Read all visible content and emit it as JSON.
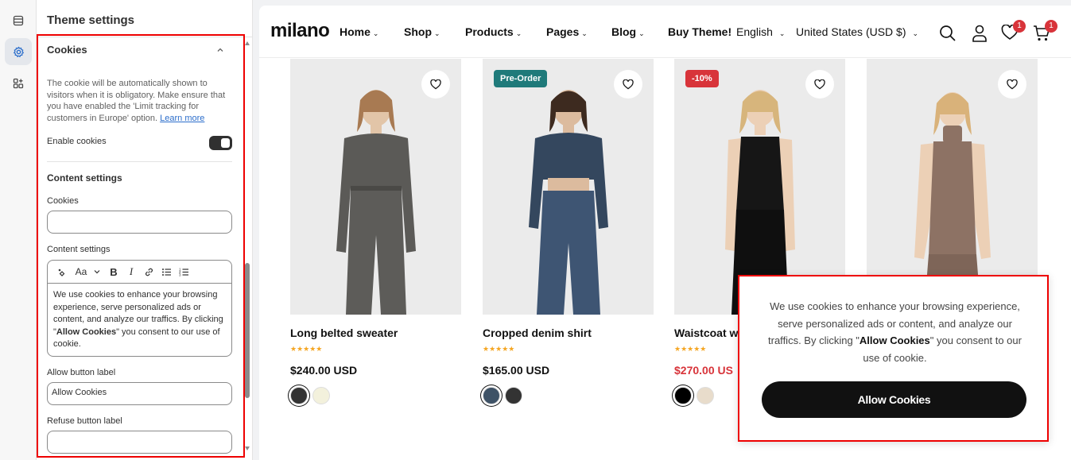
{
  "sidebar": {
    "title": "Theme settings",
    "section": {
      "title": "Cookies",
      "description": "The cookie will be automatically shown to visitors when it is obligatory. Make ensure that you have enabled the 'Limit tracking for customers in Europe' option.",
      "learn_more": "Learn more",
      "enable_label": "Enable cookies",
      "enable_value": true
    },
    "content": {
      "title": "Content settings",
      "cookies_label": "Cookies",
      "cookies_value": "",
      "rte_label": "Content settings",
      "rte_text_pre": "We use cookies to enhance your browsing experience, serve personalized ads or content, and analyze our traffics. By clicking \"",
      "rte_text_bold": "Allow Cookies",
      "rte_text_post": "\" you consent to our use of cookie.",
      "rte_font_label": "Aa",
      "allow_label": "Allow button label",
      "allow_value": "Allow Cookies",
      "refuse_label": "Refuse button label",
      "refuse_value": ""
    }
  },
  "store": {
    "logo": "milano",
    "nav": [
      "Home",
      "Shop",
      "Products",
      "Pages",
      "Blog"
    ],
    "buy_theme": "Buy Theme!",
    "language": "English",
    "currency": "United States (USD $)",
    "wishlist_count": "1",
    "cart_count": "1"
  },
  "products": [
    {
      "name": "Long belted sweater",
      "price": "$240.00 USD",
      "stars": "★★★★★",
      "tag": "",
      "sale": false
    },
    {
      "name": "Cropped denim shirt",
      "price": "$165.00 USD",
      "stars": "★★★★★",
      "tag": "Pre-Order",
      "sale": false
    },
    {
      "name": "Waistcoat w",
      "price": "$270.00 US",
      "stars": "★★★★★",
      "tag": "-10%",
      "sale": true
    },
    {
      "name": "",
      "price": "",
      "stars": "",
      "tag": "",
      "sale": false
    }
  ],
  "cookie_banner": {
    "text_pre": "We use cookies to enhance your browsing experience, serve personalized ads or content, and analyze our traffics. By clicking \"",
    "text_bold": "Allow Cookies",
    "text_post": "\" you consent to our use of cookie.",
    "button": "Allow Cookies"
  },
  "colors": {
    "accent": "#e00000",
    "preorder_tag": "#1f7a7a",
    "sale_tag": "#d8343a",
    "swatches": [
      [
        "#333333",
        "#f3f1dc"
      ],
      [
        "#3e5266",
        "#333333"
      ],
      [
        "#000000",
        "#e8dccb"
      ]
    ]
  }
}
